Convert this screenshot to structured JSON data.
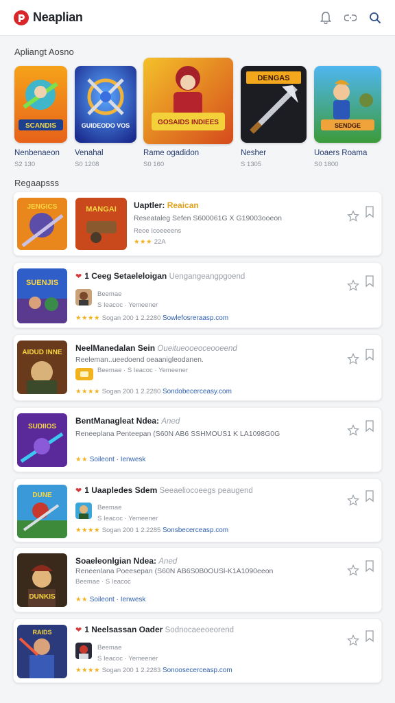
{
  "header": {
    "title": "Neaplian",
    "brand_color": "#d8262b",
    "icons": [
      "bell-icon",
      "link-icon",
      "search-icon"
    ]
  },
  "featured": {
    "heading": "Apliangt Aosno",
    "items": [
      {
        "art_label": "SCANDIS",
        "name": "Nenbenaeon",
        "meta": "S2 130"
      },
      {
        "art_label": "GUIDEODO VOS",
        "name": "Venahal",
        "meta": "S0 1208"
      },
      {
        "art_label": "GOSAIDS INDIEES",
        "name": "Rame ogadidon",
        "meta": "S0 160"
      },
      {
        "art_label": "DENGAS",
        "name": "Nesher",
        "meta": "S 1305"
      },
      {
        "art_label": "SENDGE",
        "name": "Uoaers Roama",
        "meta": "S0 1800"
      }
    ]
  },
  "list": {
    "heading": "Regaapsss",
    "rows": [
      {
        "thumb_labels": [
          "JENGICS",
          "MANGAI"
        ],
        "title": "Uaptler:",
        "title_accent": "Reaican",
        "subtitle": "",
        "desc": "Reseataleg Sefen S600061G X G19003ooeon",
        "detail": "Reoe Icoeeeens",
        "rating": "★★★",
        "rating_value": "22A",
        "link": "",
        "has_hearts": false
      },
      {
        "thumb_labels": [
          "SUENJIS"
        ],
        "title": "1 Ceeg Setaeleloigan",
        "title_accent": "",
        "subtitle": "Uengangeangpgoend",
        "desc": "Beemae",
        "detail": "S Ieacoc · Yemeener",
        "rating": "★★★★",
        "rating_value": "Sogan 200 1 2.2280",
        "link": "Sowlefosreraasp.com",
        "has_hearts": true
      },
      {
        "thumb_labels": [
          "AIDUD INNE"
        ],
        "title": "NeelManedalan Sein",
        "title_accent": "",
        "subtitle": "Oueitueooeoceooeend",
        "desc": "Reeleman..ueedoend oeaanigleodanen.",
        "detail": "Beemae · S Ieacoc · Yemeener",
        "rating": "★★★★",
        "rating_value": "Sogan 200 1 2.2280",
        "link": "Sondobecerceasy.com",
        "has_hearts": false
      },
      {
        "thumb_labels": [
          "SUDIIOS"
        ],
        "title": "BentManagleat Ndea:",
        "title_accent": "",
        "subtitle": "Aned",
        "desc": "Reneeplana Penteepan (S60N AB6 SSHMOUS1 K LA1098G0G",
        "detail": "",
        "rating": "★★",
        "rating_value": "Soileont · Ienwesk",
        "link": "",
        "has_hearts": false
      },
      {
        "thumb_labels": [
          "DUNE"
        ],
        "title": "1 Uaapledes Sdem",
        "title_accent": "",
        "subtitle": "Seeaeliocoeegs peaugend",
        "desc": "Beemae",
        "detail": "S Ieacoc · Yemeener",
        "rating": "★★★★",
        "rating_value": "Sogan 200 1 2.2285",
        "link": "Sonsbecerceasp.com",
        "has_hearts": true
      },
      {
        "thumb_labels": [
          "DUNKIS"
        ],
        "title": "Soaeleonlgian Ndea:",
        "title_accent": "",
        "subtitle": "Aned",
        "desc": "Reneenlana Poeesepan (S60N AB6S0B0OUSl-K1A1090eeon",
        "detail": "Beemae · S Ieacoc",
        "rating": "★★",
        "rating_value": "Soileont · Ienwesk",
        "link": "",
        "has_hearts": false
      },
      {
        "thumb_labels": [
          "RAIDS"
        ],
        "title": "1 Neelsassan Oader",
        "title_accent": "",
        "subtitle": "Sodnocaeeoeorend",
        "desc": "Beemae",
        "detail": "S Ieacoc · Yemeener",
        "rating": "★★★★",
        "rating_value": "Sogan 200 1 2.2283",
        "link": "Sonoosecerceasp.com",
        "has_hearts": true
      }
    ]
  }
}
